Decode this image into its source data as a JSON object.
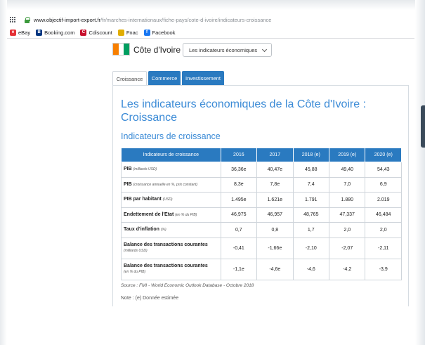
{
  "browser": {
    "url_host": "www.objectif-import-export.fr",
    "url_path": "/fr/marches-internationaux/fiche-pays/cote-d-ivoire/indicateurs-croissance",
    "bookmarks": [
      {
        "label": "eBay",
        "icon": "ebay-icon",
        "color": "#e53238",
        "glyph": "e"
      },
      {
        "label": "Booking.com",
        "icon": "booking-icon",
        "color": "#003580",
        "glyph": "B"
      },
      {
        "label": "Cdiscount",
        "icon": "cdiscount-icon",
        "color": "#c8102e",
        "glyph": "C"
      },
      {
        "label": "Fnac",
        "icon": "folder-icon",
        "color": "#e1ad01",
        "glyph": ""
      },
      {
        "label": "Facebook",
        "icon": "facebook-icon",
        "color": "#1877f2",
        "glyph": "f"
      }
    ]
  },
  "header": {
    "country_label": "Côte d'Ivoire :",
    "flag_colors": [
      "#f77f00",
      "#ffffff",
      "#009e60"
    ],
    "select_value": "Les indicateurs économiques"
  },
  "tabs": [
    {
      "label": "Croissance",
      "active": true
    },
    {
      "label": "Commerce",
      "active": false
    },
    {
      "label": "Investissement",
      "active": false
    }
  ],
  "main": {
    "title": "Les indicateurs économiques de la Côte d'Ivoire : Croissance",
    "subtitle": "Indicateurs de croissance",
    "table": {
      "headers": [
        "Indicateurs de croissance",
        "2016",
        "2017",
        "2018 (e)",
        "2019 (e)",
        "2020 (e)"
      ],
      "rows": [
        {
          "label": "PIB",
          "unit": "(milliards USD)",
          "values": [
            "36,36e",
            "40,47e",
            "45,88",
            "49,40",
            "54,43"
          ]
        },
        {
          "label": "PIB",
          "unit": "(croissance annuelle en %, prix constant)",
          "values": [
            "8,3e",
            "7,8e",
            "7,4",
            "7,0",
            "6,9"
          ]
        },
        {
          "label": "PIB par habitant",
          "unit": "(USD)",
          "values": [
            "1.495e",
            "1.621e",
            "1.791",
            "1.880",
            "2.019"
          ]
        },
        {
          "label": "Endettement de l'Etat",
          "unit": "(en % du PIB)",
          "values": [
            "46,975",
            "46,957",
            "48,765",
            "47,337",
            "46,484"
          ]
        },
        {
          "label": "Taux d'inflation",
          "unit": "(%)",
          "values": [
            "0,7",
            "0,8",
            "1,7",
            "2,0",
            "2,0"
          ]
        },
        {
          "label": "Balance des transactions courantes",
          "unit": "(milliards USD)",
          "values": [
            "-0,41",
            "-1,66e",
            "-2,10",
            "-2,07",
            "-2,11"
          ]
        },
        {
          "label": "Balance des transactions courantes",
          "unit": "(en % du PIB)",
          "values": [
            "-1,1e",
            "-4,6e",
            "-4,6",
            "-4,2",
            "-3,9"
          ]
        }
      ]
    },
    "source": "Source : FMI - World Economic Outlook Database - Octobre 2018",
    "note": "Note : (e) Donnée estimée"
  }
}
